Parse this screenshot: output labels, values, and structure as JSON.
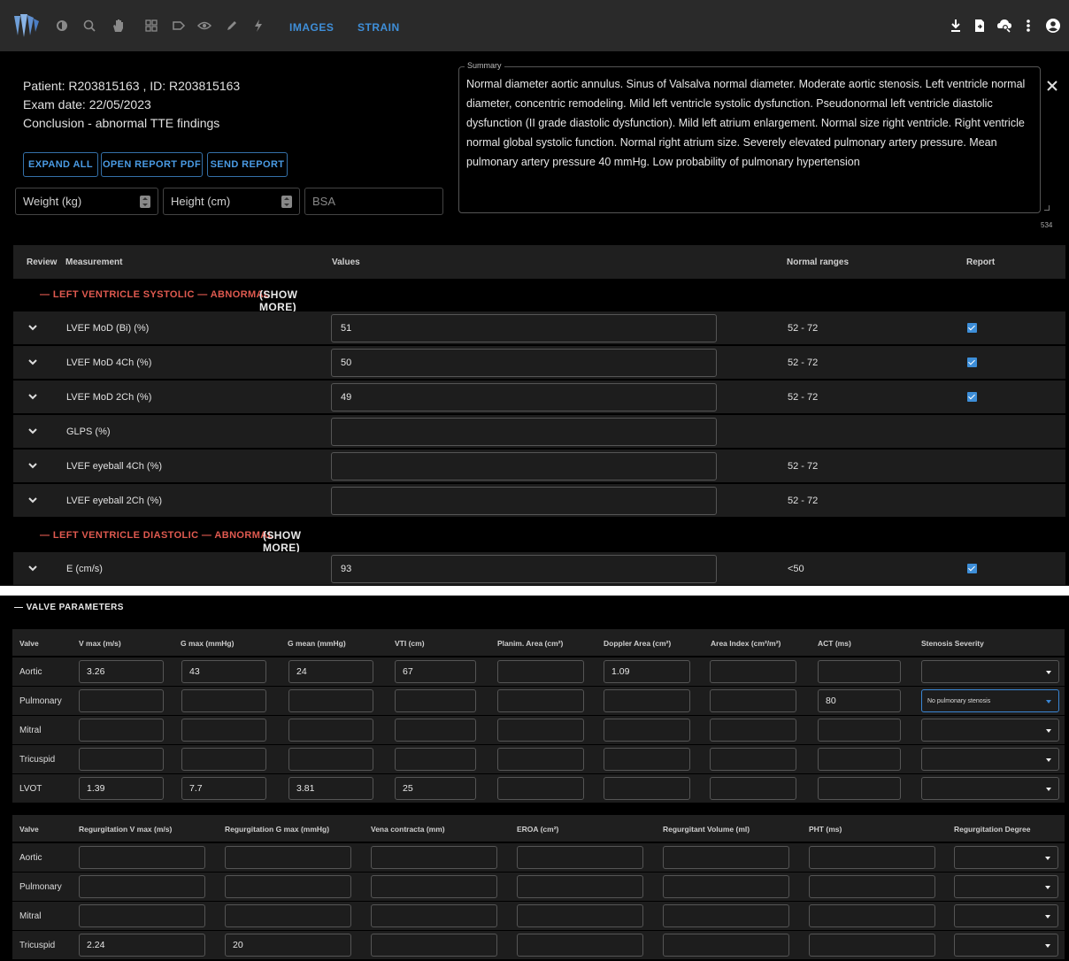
{
  "toolbar": {
    "tools": [
      "brightness-icon",
      "zoom-icon",
      "pan-hand-icon",
      "grid-icon",
      "label-tag-icon",
      "eye-icon",
      "pencil-icon",
      "lightning-icon"
    ],
    "tabs": [
      "IMAGES",
      "STRAIN"
    ],
    "right_icons": [
      "download-icon",
      "file-export-icon",
      "cloud-search-icon",
      "more-vertical-icon",
      "account-icon"
    ]
  },
  "patient": {
    "line1": "Patient: R203815163 , ID: R203815163",
    "line2": "Exam date: 22/05/2023",
    "line3": "Conclusion - abnormal TTE findings"
  },
  "actions": {
    "expand_all": "EXPAND ALL",
    "open_report": "OPEN REPORT PDF",
    "send_report": "SEND REPORT"
  },
  "fields": {
    "weight": "Weight (kg)",
    "height": "Height (cm)",
    "bsa": "BSA"
  },
  "summary": {
    "legend": "Summary",
    "text": "Normal diameter aortic annulus. Sinus of Valsalva normal diameter. Moderate aortic stenosis. Left ventricle normal diameter, concentric remodeling. Mild left ventricle systolic dysfunction. Pseudonormal left ventricle diastolic dysfunction (II grade diastolic dysfunction). Mild left atrium enlargement. Normal size right ventricle. Right ventricle normal global systolic function. Normal right atrium size. Severely elevated pulmonary artery pressure. Mean pulmonary artery pressure 40 mmHg. Low probability of pulmonary hypertension",
    "char_count": "534"
  },
  "measure_table": {
    "headers": {
      "review": "Review",
      "measurement": "Measurement",
      "values": "Values",
      "normal": "Normal ranges",
      "report": "Report"
    },
    "sections": [
      {
        "title": "— LEFT VENTRICLE SYSTOLIC — ABNORMAL",
        "show_more": "(SHOW MORE)"
      },
      {
        "title": "— LEFT VENTRICLE DIASTOLIC — ABNORMAL",
        "show_more": "(SHOW MORE)"
      }
    ],
    "rows": [
      {
        "label": "LVEF MoD (Bi) (%)",
        "value": "51",
        "range": "52 - 72",
        "report": true
      },
      {
        "label": "LVEF MoD 4Ch (%)",
        "value": "50",
        "range": "52 - 72",
        "report": true
      },
      {
        "label": "LVEF MoD 2Ch (%)",
        "value": "49",
        "range": "52 - 72",
        "report": true
      },
      {
        "label": "GLPS (%)",
        "value": "",
        "range": "",
        "report": false
      },
      {
        "label": "LVEF eyeball 4Ch (%)",
        "value": "",
        "range": "52 - 72",
        "report": false
      },
      {
        "label": "LVEF eyeball 2Ch (%)",
        "value": "",
        "range": "52 - 72",
        "report": false
      },
      {
        "label": "E (cm/s)",
        "value": "93",
        "range": "<50",
        "report": true
      }
    ]
  },
  "valve": {
    "title": "— VALVE PARAMETERS",
    "stenosis_headers": [
      "Valve",
      "V max (m/s)",
      "G max (mmHg)",
      "G mean (mmHg)",
      "VTI (cm)",
      "Planim. Area (cm²)",
      "Doppler Area (cm²)",
      "Area Index (cm²/m²)",
      "ACT (ms)",
      "Stenosis Severity"
    ],
    "stenosis_rows": [
      {
        "name": "Aortic",
        "cells": [
          "3.26",
          "43",
          "24",
          "67",
          "",
          "1.09",
          "",
          ""
        ],
        "severity": ""
      },
      {
        "name": "Pulmonary",
        "cells": [
          "",
          "",
          "",
          "",
          "",
          "",
          "",
          "80"
        ],
        "severity": "No pulmonary stenosis"
      },
      {
        "name": "Mitral",
        "cells": [
          "",
          "",
          "",
          "",
          "",
          "",
          "",
          ""
        ],
        "severity": ""
      },
      {
        "name": "Tricuspid",
        "cells": [
          "",
          "",
          "",
          "",
          "",
          "",
          "",
          ""
        ],
        "severity": ""
      },
      {
        "name": "LVOT",
        "cells": [
          "1.39",
          "7.7",
          "3.81",
          "25",
          "",
          "",
          "",
          ""
        ],
        "severity": ""
      }
    ],
    "regurg_headers": [
      "Valve",
      "Regurgitation V max (m/s)",
      "Regurgitation G max (mmHg)",
      "Vena contracta (mm)",
      "EROA (cm²)",
      "Regurgitant Volume (ml)",
      "PHT (ms)",
      "Regurgitation Degree"
    ],
    "regurg_rows": [
      {
        "name": "Aortic",
        "cells": [
          "",
          "",
          "",
          "",
          "",
          ""
        ],
        "degree": ""
      },
      {
        "name": "Pulmonary",
        "cells": [
          "",
          "",
          "",
          "",
          "",
          ""
        ],
        "degree": ""
      },
      {
        "name": "Mitral",
        "cells": [
          "",
          "",
          "",
          "",
          "",
          ""
        ],
        "degree": ""
      },
      {
        "name": "Tricuspid",
        "cells": [
          "2.24",
          "20",
          "",
          "",
          "",
          ""
        ],
        "degree": ""
      }
    ]
  }
}
